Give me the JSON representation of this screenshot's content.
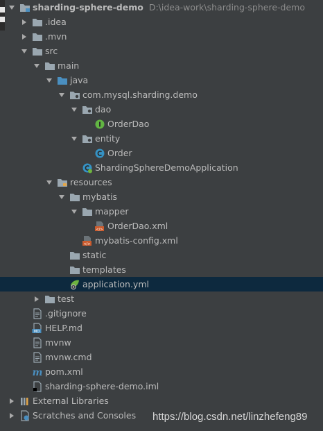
{
  "project": {
    "name": "sharding-sphere-demo",
    "path": "D:\\idea-work\\sharding-sphere-demo"
  },
  "tree": [
    {
      "label": "sharding-sphere-demo",
      "icon": "module-folder-icon",
      "state": "expanded"
    },
    {
      "label": ".idea",
      "icon": "folder-icon",
      "state": "collapsed"
    },
    {
      "label": ".mvn",
      "icon": "folder-icon",
      "state": "collapsed"
    },
    {
      "label": "src",
      "icon": "folder-icon",
      "state": "expanded"
    },
    {
      "label": "main",
      "icon": "folder-icon",
      "state": "expanded"
    },
    {
      "label": "java",
      "icon": "source-folder-icon",
      "state": "expanded"
    },
    {
      "label": "com.mysql.sharding.demo",
      "icon": "package-icon",
      "state": "expanded"
    },
    {
      "label": "dao",
      "icon": "package-icon",
      "state": "expanded"
    },
    {
      "label": "OrderDao",
      "icon": "interface-icon",
      "state": "leaf"
    },
    {
      "label": "entity",
      "icon": "package-icon",
      "state": "expanded"
    },
    {
      "label": "Order",
      "icon": "class-icon",
      "state": "leaf"
    },
    {
      "label": "ShardingSphereDemoApplication",
      "icon": "spring-boot-class-icon",
      "state": "leaf"
    },
    {
      "label": "resources",
      "icon": "resources-folder-icon",
      "state": "expanded"
    },
    {
      "label": "mybatis",
      "icon": "folder-icon",
      "state": "expanded"
    },
    {
      "label": "mapper",
      "icon": "folder-icon",
      "state": "expanded"
    },
    {
      "label": "OrderDao.xml",
      "icon": "xml-file-icon",
      "state": "leaf"
    },
    {
      "label": "mybatis-config.xml",
      "icon": "xml-file-icon",
      "state": "leaf"
    },
    {
      "label": "static",
      "icon": "folder-icon",
      "state": "leaf"
    },
    {
      "label": "templates",
      "icon": "folder-icon",
      "state": "leaf"
    },
    {
      "label": "application.yml",
      "icon": "spring-yml-icon",
      "state": "leaf",
      "selected": true
    },
    {
      "label": "test",
      "icon": "folder-icon",
      "state": "collapsed"
    },
    {
      "label": ".gitignore",
      "icon": "text-file-icon",
      "state": "leaf"
    },
    {
      "label": "HELP.md",
      "icon": "markdown-file-icon",
      "state": "leaf"
    },
    {
      "label": "mvnw",
      "icon": "text-file-icon",
      "state": "leaf"
    },
    {
      "label": "mvnw.cmd",
      "icon": "text-file-icon",
      "state": "leaf"
    },
    {
      "label": "pom.xml",
      "icon": "maven-icon",
      "state": "leaf"
    },
    {
      "label": "sharding-sphere-demo.iml",
      "icon": "iml-file-icon",
      "state": "leaf"
    },
    {
      "label": "External Libraries",
      "icon": "libraries-icon",
      "state": "collapsed"
    },
    {
      "label": "Scratches and Consoles",
      "icon": "scratches-icon",
      "state": "collapsed"
    }
  ],
  "watermark": "https://blog.csdn.net/linzhefeng89",
  "colors": {
    "background": "#3c3f41",
    "selection": "#0d293e",
    "text": "#bbbbbb",
    "folder": "#9aa7b0",
    "source_folder": "#4a8fc0",
    "interface": "#62b543",
    "class": "#3592c4",
    "xml": "#cc5c2e"
  }
}
